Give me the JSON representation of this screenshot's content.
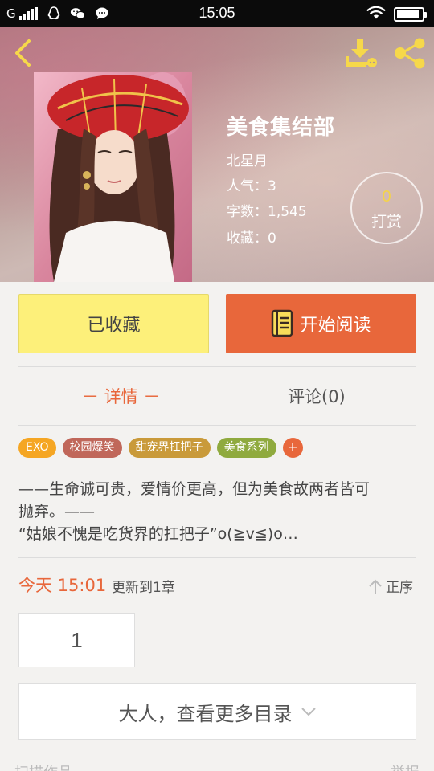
{
  "status_bar": {
    "carrier": "G",
    "time": "15:05",
    "signal_icon": "signal-icon",
    "wifi_icon": "wifi-icon",
    "battery_level": 0.9
  },
  "header": {
    "back_icon": "back-arrow-icon",
    "download_icon": "download-icon",
    "share_icon": "share-icon"
  },
  "book": {
    "title": "美食集结部",
    "author": "北星月",
    "popularity_label": "人气：3",
    "word_count_label": "字数：1,545",
    "favorites_label": "收藏：0",
    "reward_count": "0",
    "reward_label": "打赏"
  },
  "actions": {
    "collected_label": "已收藏",
    "read_label": "开始阅读"
  },
  "tabs": {
    "detail": "－ 详情 －",
    "comments": "评论(0)"
  },
  "tags": [
    {
      "label": "EXO",
      "color": "#f5a623"
    },
    {
      "label": "校园爆笑",
      "color": "#c0675a"
    },
    {
      "label": "甜宠界扛把子",
      "color": "#c99a3a"
    },
    {
      "label": "美食系列",
      "color": "#8faa3e"
    }
  ],
  "tag_add_label": "+",
  "description": {
    "line1": " ——生命诚可贵，爱情价更高，但为美食故两者皆可",
    "line2": "抛弃。——",
    "line3": "  “姑娘不愧是吃货界的扛把子”o(≧v≦)o…"
  },
  "update": {
    "time": "今天 15:01",
    "text": "更新到1章",
    "sort_label": "正序"
  },
  "chapters": {
    "first": "1",
    "more_label": "大人，查看更多目录"
  },
  "colors": {
    "accent": "#e8673b",
    "collected_bg": "#fdf07a",
    "reward_count": "#f4d34b"
  }
}
